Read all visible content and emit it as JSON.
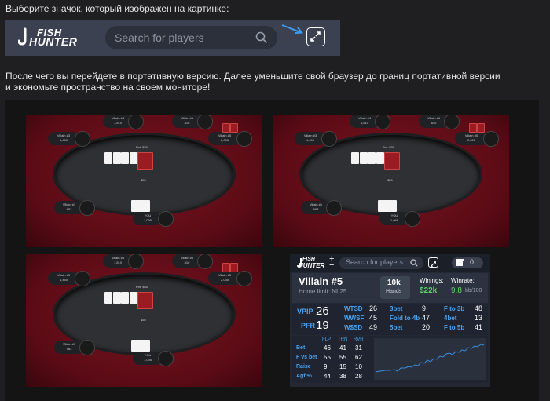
{
  "instruction": "Выберите значок, который изображен на картинке:",
  "topbar": {
    "logo_line1": "FISH",
    "logo_line2": "HUNTER",
    "search_placeholder": "Search for players",
    "search_icon": "search-icon",
    "expand_icon": "expand-icon",
    "arrow_icon": "arrow-icon"
  },
  "paragraph": {
    "line1": "После чего вы перейдете в портативную версию. Далее уменьшите свой браузер до границ портативной версии",
    "line2": "и экономьте пространство на своем мониторе!"
  },
  "tables": [
    {
      "pot": "Pot: $55",
      "seats": [
        {
          "name": "Villain #4",
          "stack": "1,810"
        },
        {
          "name": "Villain #6",
          "stack": "810"
        },
        {
          "name": "Villain #3",
          "stack": "1,450"
        },
        {
          "name": "Villain #5",
          "stack": "2,055"
        },
        {
          "name": "Villain #1",
          "stack": "983"
        },
        {
          "name": "YOU",
          "stack": "1,095"
        }
      ],
      "bet": "$55"
    },
    {
      "pot": "Pot: $55",
      "seats": [
        {
          "name": "Villain #4",
          "stack": "1,810"
        },
        {
          "name": "Villain #6",
          "stack": "810"
        },
        {
          "name": "Villain #3",
          "stack": "1,450"
        },
        {
          "name": "Villain #5",
          "stack": "2,055"
        },
        {
          "name": "Villain #1",
          "stack": "983"
        },
        {
          "name": "YOU",
          "stack": "1,095"
        }
      ],
      "bet": "$55"
    },
    {
      "pot": "Pot: $55",
      "seats": [
        {
          "name": "Villain #4",
          "stack": "1,810"
        },
        {
          "name": "Villain #6",
          "stack": "810"
        },
        {
          "name": "Villain #3",
          "stack": "1,450"
        },
        {
          "name": "Villain #5",
          "stack": "2,055"
        },
        {
          "name": "Villain #1",
          "stack": "983"
        },
        {
          "name": "YOU",
          "stack": "1,095"
        }
      ],
      "bet": "$55"
    }
  ],
  "hud": {
    "logo_line1": "FISH",
    "logo_line2": "HUNTER",
    "plus": "+",
    "minus": "−",
    "search_placeholder": "Search for players",
    "counter": "0",
    "player": "Villain #5",
    "home_limit": "Home limit: NL25",
    "hands_value": "10k",
    "hands_label": "Hands",
    "winnings_label": "Winings:",
    "winnings_value": "$22k",
    "winrate_label": "Winrate:",
    "winrate_value": "9.8",
    "winrate_unit": "bb/100",
    "vpip_label": "VPIP",
    "vpip": "26",
    "pfr_label": "PFR",
    "pfr": "19",
    "mid_stats": [
      {
        "l": "WTSD",
        "v": "26"
      },
      {
        "l": "WWSF",
        "v": "45"
      },
      {
        "l": "W$SD",
        "v": "49"
      }
    ],
    "bet_stats": [
      {
        "l": "3bet",
        "v": "9"
      },
      {
        "l": "Fold to 4b",
        "v": "47"
      },
      {
        "l": "5bet",
        "v": "20"
      }
    ],
    "fold_stats": [
      {
        "l": "F to 3b",
        "v": "48"
      },
      {
        "l": "4bet",
        "v": "13"
      },
      {
        "l": "F to 5b",
        "v": "41"
      }
    ],
    "street_headers": [
      "FLP",
      "TRN",
      "RVR"
    ],
    "street_rows": [
      {
        "l": "Bet",
        "v": [
          "46",
          "41",
          "31"
        ]
      },
      {
        "l": "F vs bet",
        "v": [
          "55",
          "55",
          "62"
        ]
      },
      {
        "l": "Raise",
        "v": [
          "9",
          "15",
          "10"
        ]
      },
      {
        "l": "Agf %",
        "v": [
          "44",
          "38",
          "28"
        ]
      }
    ]
  }
}
